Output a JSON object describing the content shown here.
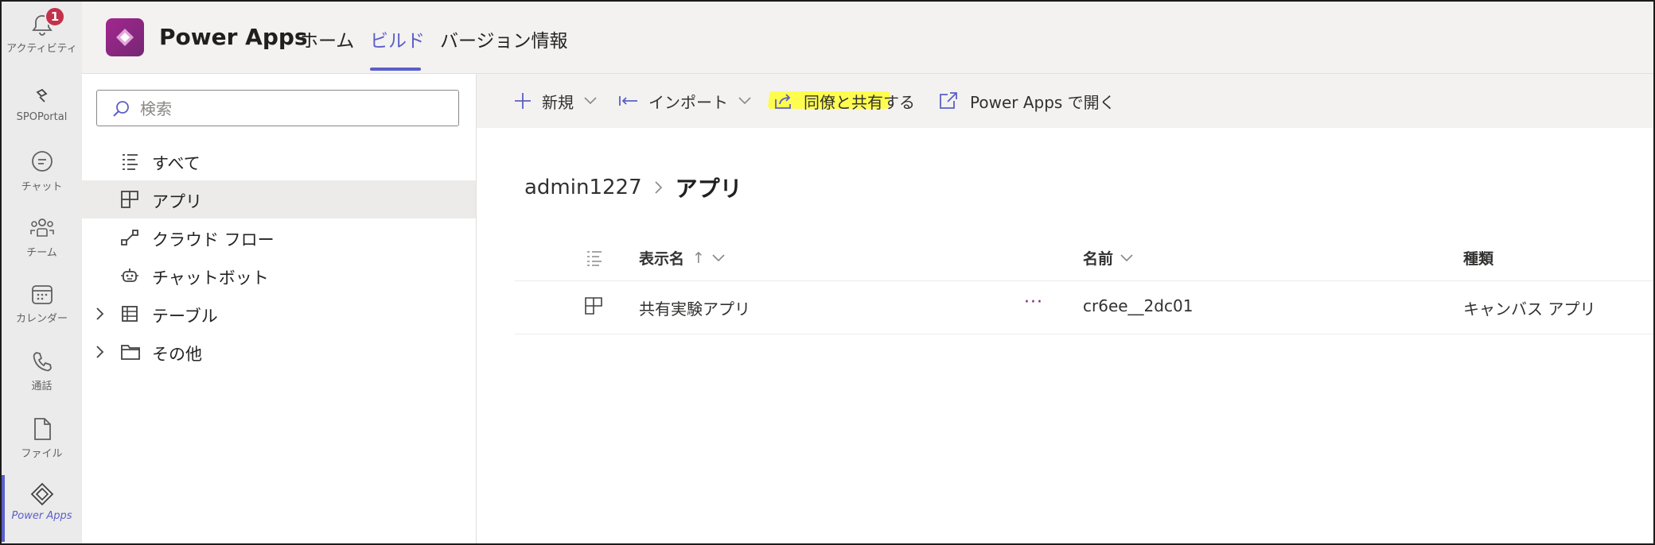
{
  "rail": {
    "items": [
      {
        "label": "アクティビティ",
        "icon": "bell-icon",
        "badge": "1"
      },
      {
        "label": "SPOPortal",
        "icon": "spo-icon"
      },
      {
        "label": "チャット",
        "icon": "chat-icon"
      },
      {
        "label": "チーム",
        "icon": "teams-icon"
      },
      {
        "label": "カレンダー",
        "icon": "calendar-icon"
      },
      {
        "label": "通話",
        "icon": "phone-icon"
      },
      {
        "label": "ファイル",
        "icon": "file-icon"
      },
      {
        "label": "Power Apps",
        "icon": "power-apps-icon"
      }
    ]
  },
  "header": {
    "app_title": "Power Apps",
    "tabs": [
      "ホーム",
      "ビルド",
      "バージョン情報"
    ],
    "active_tab": "ビルド"
  },
  "left_pane": {
    "search_placeholder": "検索",
    "items": [
      {
        "label": "すべて",
        "icon": "list-icon"
      },
      {
        "label": "アプリ",
        "icon": "app-icon",
        "selected": true
      },
      {
        "label": "クラウド フロー",
        "icon": "flow-icon"
      },
      {
        "label": "チャットボット",
        "icon": "bot-icon"
      },
      {
        "label": "テーブル",
        "icon": "table-icon",
        "expandable": true
      },
      {
        "label": "その他",
        "icon": "folder-icon",
        "expandable": true
      }
    ]
  },
  "commands": {
    "new": "新規",
    "import": "インポート",
    "share": "同僚と共有する",
    "open": "Power Apps で開く"
  },
  "breadcrumb": {
    "parent": "admin1227",
    "current": "アプリ"
  },
  "grid": {
    "columns": [
      "表示名",
      "名前",
      "種類"
    ],
    "sort_indicator": "↑",
    "rows": [
      {
        "display_name": "共有実験アプリ",
        "more": "···",
        "name": "cr6ee__2dc01",
        "type": "キャンバス アプリ"
      }
    ]
  },
  "colors": {
    "accent": "#5b5fc7",
    "powerapps": "#742774",
    "highlight": "#ffff33",
    "badge": "#c4314b"
  }
}
